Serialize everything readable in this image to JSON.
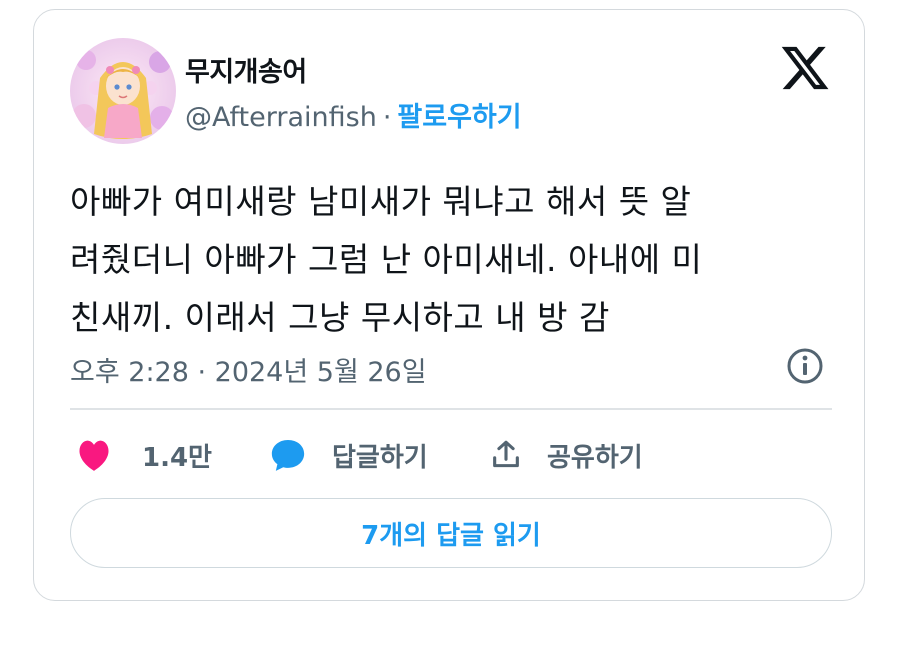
{
  "author": {
    "display_name": "무지개송어",
    "handle": "@Afterrainfish",
    "separator": "·",
    "follow_label": "팔로우하기"
  },
  "tweet": {
    "lines": [
      "아빠가 여미새랑 남미새가 뭐냐고 해서 뜻 알",
      "려줬더니 아빠가 그럼 난 아미새네. 아내에 미",
      "친새끼. 이래서 그냥 무시하고 내 방 감"
    ],
    "timestamp": "오후 2:28 · 2024년 5월 26일"
  },
  "actions": {
    "like_count": "1.4만",
    "reply_label": "답글하기",
    "share_label": "공유하기"
  },
  "read_replies_label": "7개의 답글 읽기",
  "icons": {
    "platform": "x-logo-icon",
    "info": "info-icon",
    "like": "heart-icon",
    "reply": "speech-bubble-icon",
    "share": "share-icon"
  },
  "colors": {
    "accent": "#1d9bf0",
    "like": "#f91880",
    "muted": "#536471"
  }
}
